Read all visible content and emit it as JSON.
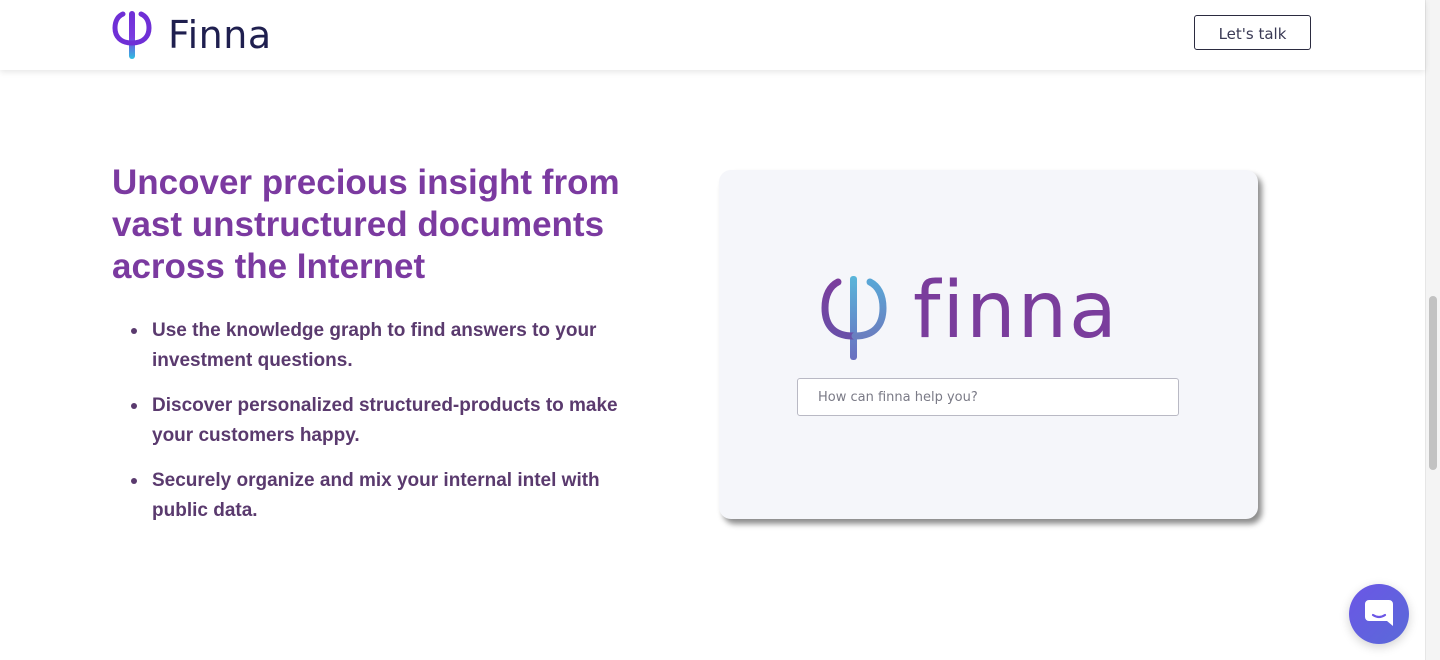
{
  "header": {
    "brand_name": "Finna",
    "cta_label": "Let's talk"
  },
  "hero": {
    "title": "Uncover precious insight from vast unstructured documents across the Internet",
    "features": [
      "Use the knowledge graph to find answers to your investment questions.",
      "Discover personalized structured-products to make your customers happy.",
      "Securely organize and mix your internal intel with public data."
    ]
  },
  "preview": {
    "logo_text": "finna",
    "search_placeholder": "How can finna help you?",
    "search_value": ""
  },
  "icons": {
    "brand": "phi-logo-icon",
    "chat": "chat-bubble-icon"
  },
  "colors": {
    "accent": "#7b3aa0",
    "brand_text": "#1f1f4f",
    "feature_text": "#5a3a6e",
    "chat_button": "#6b56e6"
  }
}
